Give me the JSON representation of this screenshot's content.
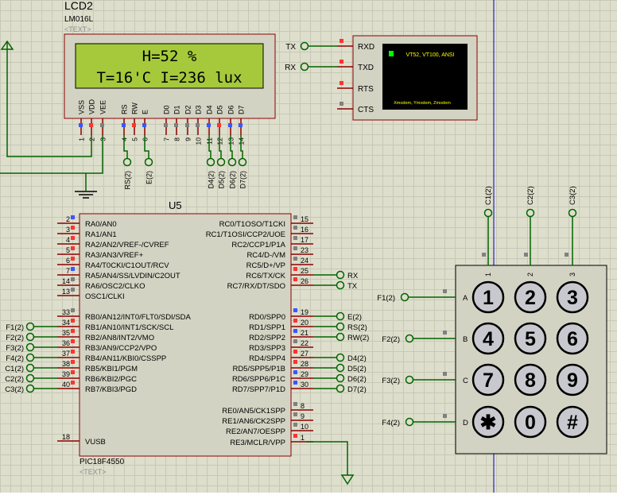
{
  "lcd": {
    "ref": "LCD2",
    "model": "LM016L",
    "text_tag": "<TEXT>",
    "line1": "H=52 %",
    "line2": "T=16'C I=236 lux",
    "pins": [
      {
        "name": "VSS",
        "num": "1"
      },
      {
        "name": "VDD",
        "num": "2"
      },
      {
        "name": "VEE",
        "num": "3"
      },
      {
        "name": "RS",
        "num": "4"
      },
      {
        "name": "RW",
        "num": "5"
      },
      {
        "name": "E",
        "num": "6"
      },
      {
        "name": "D0",
        "num": "7"
      },
      {
        "name": "D1",
        "num": "8"
      },
      {
        "name": "D2",
        "num": "9"
      },
      {
        "name": "D3",
        "num": "10"
      },
      {
        "name": "D4",
        "num": "11"
      },
      {
        "name": "D5",
        "num": "12"
      },
      {
        "name": "D6",
        "num": "13"
      },
      {
        "name": "D7",
        "num": "14"
      }
    ],
    "net_labels": [
      "RS(2)",
      "E(2)",
      "D4(2)",
      "D5(2)",
      "D6(2)",
      "D7(2)"
    ]
  },
  "terminal": {
    "pins": [
      "RXD",
      "TXD",
      "RTS",
      "CTS"
    ],
    "nets": [
      "TX",
      "RX"
    ],
    "title": "VT52, VT100, ANSI",
    "footer": "Xmodem, Ymodem, Zmodem",
    "screen_color": "#000000",
    "cursor_color": "#00ff00",
    "text_color": "#ffff00"
  },
  "mcu": {
    "ref": "U5",
    "part": "PIC18F4550",
    "text_tag": "<TEXT>",
    "left_pins": [
      {
        "num": "2",
        "name": "RA0/AN0",
        "net": ""
      },
      {
        "num": "3",
        "name": "RA1/AN1",
        "net": ""
      },
      {
        "num": "4",
        "name": "RA2/AN2/VREF-/CVREF",
        "net": ""
      },
      {
        "num": "5",
        "name": "RA3/AN3/VREF+",
        "net": ""
      },
      {
        "num": "6",
        "name": "RA4/T0CKI/C1OUT/RCV",
        "net": ""
      },
      {
        "num": "7",
        "name": "RA5/AN4/SS/LVDIN/C2OUT",
        "net": ""
      },
      {
        "num": "14",
        "name": "RA6/OSC2/CLKO",
        "net": ""
      },
      {
        "num": "13",
        "name": "OSC1/CLKI",
        "net": ""
      },
      {
        "num": "33",
        "name": "RB0/AN12/INT0/FLT0/SDI/SDA",
        "net": ""
      },
      {
        "num": "34",
        "name": "RB1/AN10/INT1/SCK/SCL",
        "net": "F1(2)"
      },
      {
        "num": "35",
        "name": "RB2/AN8/INT2/VMO",
        "net": "F2(2)"
      },
      {
        "num": "36",
        "name": "RB3/AN9/CCP2/VPO",
        "net": "F3(2)"
      },
      {
        "num": "37",
        "name": "RB4/AN11/KBI0/CSSPP",
        "net": "F4(2)"
      },
      {
        "num": "38",
        "name": "RB5/KBI1/PGM",
        "net": "C1(2)"
      },
      {
        "num": "39",
        "name": "RB6/KBI2/PGC",
        "net": "C2(2)"
      },
      {
        "num": "40",
        "name": "RB7/KBI3/PGD",
        "net": "C3(2)"
      },
      {
        "num": "18",
        "name": "VUSB",
        "net": ""
      }
    ],
    "right_pins": [
      {
        "num": "15",
        "name": "RC0/T1OSO/T1CKI",
        "net": ""
      },
      {
        "num": "16",
        "name": "RC1/T1OSI/CCP2/UOE",
        "net": ""
      },
      {
        "num": "17",
        "name": "RC2/CCP1/P1A",
        "net": ""
      },
      {
        "num": "23",
        "name": "RC4/D-/VM",
        "net": ""
      },
      {
        "num": "24",
        "name": "RC5/D+/VP",
        "net": ""
      },
      {
        "num": "25",
        "name": "RC6/TX/CK",
        "net": "RX"
      },
      {
        "num": "26",
        "name": "RC7/RX/DT/SDO",
        "net": "TX"
      },
      {
        "num": "19",
        "name": "RD0/SPP0",
        "net": "E(2)"
      },
      {
        "num": "20",
        "name": "RD1/SPP1",
        "net": "RS(2)"
      },
      {
        "num": "21",
        "name": "RD2/SPP2",
        "net": "RW(2)"
      },
      {
        "num": "22",
        "name": "RD3/SPP3",
        "net": ""
      },
      {
        "num": "27",
        "name": "RD4/SPP4",
        "net": "D4(2)"
      },
      {
        "num": "28",
        "name": "RD5/SPP5/P1B",
        "net": "D5(2)"
      },
      {
        "num": "29",
        "name": "RD6/SPP6/P1C",
        "net": "D6(2)"
      },
      {
        "num": "30",
        "name": "RD7/SPP7/P1D",
        "net": "D7(2)"
      },
      {
        "num": "8",
        "name": "RE0/AN5/CK1SPP",
        "net": ""
      },
      {
        "num": "9",
        "name": "RE1/AN6/CK2SPP",
        "net": ""
      },
      {
        "num": "10",
        "name": "RE2/AN7/OESPP",
        "net": ""
      },
      {
        "num": "1",
        "name": "RE3/MCLR/VPP",
        "net": ""
      }
    ]
  },
  "keypad": {
    "col_nets": [
      "C1(2)",
      "C2(2)",
      "C3(2)"
    ],
    "col_nums": [
      "1",
      "2",
      "3"
    ],
    "row_nets": [
      "F1(2)",
      "F2(2)",
      "F3(2)",
      "F4(2)"
    ],
    "row_letters": [
      "A",
      "B",
      "C",
      "D"
    ],
    "keys": [
      "1",
      "2",
      "3",
      "4",
      "5",
      "6",
      "7",
      "8",
      "9",
      "✱",
      "0",
      "#"
    ]
  },
  "colors": {
    "wire": "#006400",
    "pin": "#8b0000",
    "chip_fill": "#d3d3c3",
    "lcd_screen": "#a5c93b",
    "probe_blue": "#3d56ff",
    "probe_red": "#ff3333",
    "probe_gray": "#808080",
    "marker_line": "#0000cc"
  }
}
